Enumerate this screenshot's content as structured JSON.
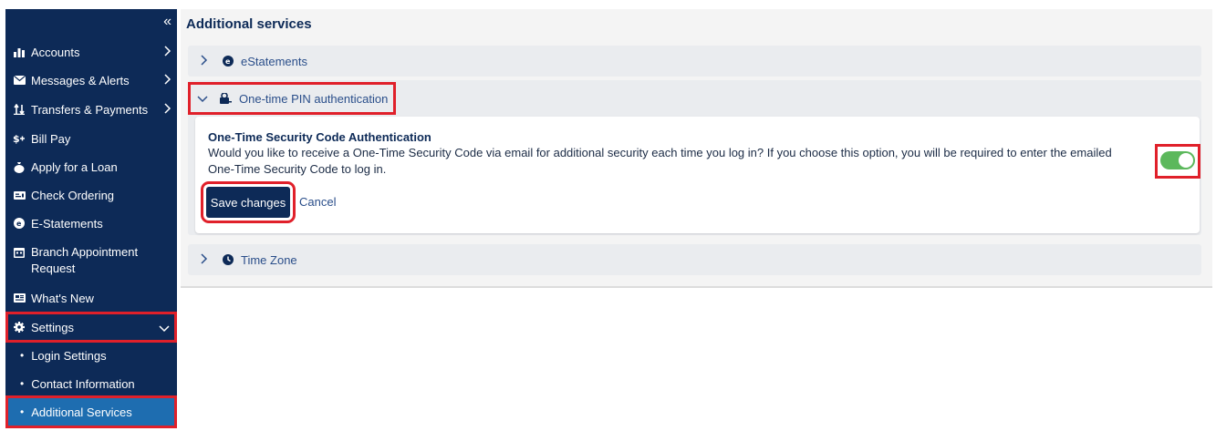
{
  "sidebar": {
    "collapse_glyph": "«",
    "items": [
      {
        "label": "Accounts",
        "icon": "bar-chart-icon"
      },
      {
        "label": "Messages & Alerts",
        "icon": "envelope-icon"
      },
      {
        "label": "Transfers & Payments",
        "icon": "transfer-icon"
      },
      {
        "label": "Bill Pay",
        "icon": "bill-pay-icon"
      },
      {
        "label": "Apply for a Loan",
        "icon": "money-bag-icon"
      },
      {
        "label": "Check Ordering",
        "icon": "check-icon"
      },
      {
        "label": "E-Statements",
        "icon": "estatement-icon"
      },
      {
        "label": "Branch Appointment Request",
        "icon": "calendar-icon"
      },
      {
        "label": "What's New",
        "icon": "newspaper-icon"
      },
      {
        "label": "Settings",
        "icon": "gear-icon"
      }
    ],
    "settings_sub": [
      {
        "label": "Login Settings"
      },
      {
        "label": "Contact Information"
      },
      {
        "label": "Additional Services"
      }
    ]
  },
  "main": {
    "title": "Additional services",
    "panels": {
      "estatements": {
        "label": "eStatements"
      },
      "otp": {
        "label": "One-time PIN authentication",
        "section_title": "One-Time Security Code Authentication",
        "description": "Would you like to receive a One-Time Security Code via email for additional security each time you log in? If you choose this option, you will be required to enter the emailed One-Time Security Code to log in.",
        "save_label": "Save changes",
        "cancel_label": "Cancel",
        "toggle_on": true
      },
      "timezone": {
        "label": "Time Zone"
      }
    }
  },
  "colors": {
    "sidebar_bg": "#0d2a57",
    "active_item": "#1e6db0",
    "toggle_on": "#5cb85c",
    "highlight": "#e0202a"
  }
}
